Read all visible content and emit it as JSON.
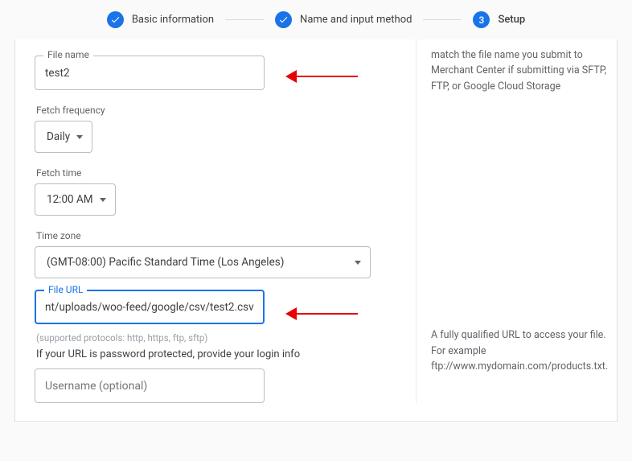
{
  "stepper": {
    "step1": "Basic information",
    "step2": "Name and input method",
    "step3_num": "3",
    "step3": "Setup"
  },
  "filename": {
    "label": "File name",
    "value": "test2",
    "help": "match the file name you submit to Merchant Center if submitting via SFTP, FTP, or Google Cloud Storage"
  },
  "fetch_frequency": {
    "label": "Fetch frequency",
    "value": "Daily"
  },
  "fetch_time": {
    "label": "Fetch time",
    "value": "12:00 AM"
  },
  "timezone": {
    "label": "Time zone",
    "value": "(GMT-08:00) Pacific Standard Time (Los Angeles)"
  },
  "file_url": {
    "label": "File URL",
    "value": "nt/uploads/woo-feed/google/csv/test2.csv",
    "help": "A fully qualified URL to access your file. For example ftp://www.mydomain.com/products.txt.",
    "protocols": "(supported protocols: http, https, ftp, sftp)"
  },
  "auth": {
    "instruction": "If your URL is password protected, provide your login info",
    "username_placeholder": "Username (optional)"
  }
}
